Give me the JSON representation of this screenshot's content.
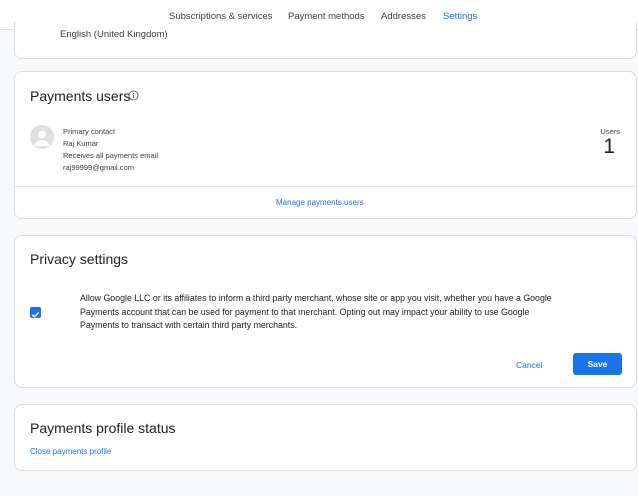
{
  "tabs": [
    {
      "label": "Subscriptions & services"
    },
    {
      "label": "Payment methods"
    },
    {
      "label": "Addresses"
    },
    {
      "label": "Settings",
      "active": true
    }
  ],
  "language": {
    "value": "English (United Kingdom)"
  },
  "payments_users": {
    "title": "Payments users",
    "contact": {
      "role": "Primary contact",
      "name": "Raj Kumar",
      "note": "Receives all payments email",
      "email": "raj99999@gmail.com"
    },
    "users_label": "Users",
    "users_count": "1",
    "manage_link": "Manage payments users"
  },
  "privacy": {
    "title": "Privacy settings",
    "checked": true,
    "lines": [
      "Allow Google LLC or its affiliates to inform a third party merchant, whose site or app you visit, whether you have a Google",
      "Payments account that can be used for payment to that merchant. Opting out may impact your ability to use Google",
      "Payments to transact with certain third party merchants."
    ],
    "cancel_label": "Cancel",
    "save_label": "Save"
  },
  "profile_status": {
    "title": "Payments profile status",
    "close_link": "Close payments profile"
  },
  "colors": {
    "accent": "#1a73e8",
    "border": "#dadce0",
    "background": "#f8f9fa"
  }
}
